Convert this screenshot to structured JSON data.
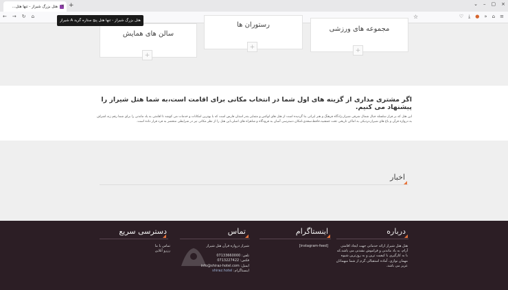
{
  "browser": {
    "tab_title": "هتل بزرگ شیراز - تنها هتل...",
    "tab_close": "×",
    "new_tab": "+",
    "tooltip": "هتل بزرگ شیراز - تنها هتل پنج ستاره گرید A شیراز",
    "nav_icons": [
      "←",
      "→",
      "↻",
      "⌂"
    ],
    "right_icons": [
      "♡",
      "⤓",
      "●",
      "»",
      "⌂",
      "≡"
    ],
    "window_buttons": [
      "⌄",
      "–",
      "▢",
      "×"
    ],
    "star": "☆"
  },
  "cards": {
    "halls": "سالن های همایش",
    "restaurants": "رستوران ها",
    "sports": "مجموعه های ورزشی",
    "plus": "+"
  },
  "intro": {
    "title": "اگر مشتری مداری از گزینه های اول شما در انتخاب مکانی برای اقامت است،به شما هتل شیراز را پیشنهاد می کنیم.",
    "text": "این هتل که بر فراز سلسله جبال شمال شرقی شیراز،زادگاه فرهنگ و هنر ایرانی بنا گردیده است از هتل های لوکس و متمایز بندر استان فارس است که با بهترین امکانات و خدمات می کوشد تا اقامتی به یاد ماندنی را برای شما رقم زند.اشراف به دروازه قرآن و باغ های شیراز،نزدیکی به اماکن تاریخی تخت جمشید،حافظ،سعدی،امکان دسترسی آسان به فرودگاه و شاهراه های اصلی،این هتل را از نظر مکانی نیز در شرایطی منحصر به فرد قرار داده است."
  },
  "news": {
    "title": "اخبار"
  },
  "footer": {
    "about": {
      "title": "درباره",
      "text": "هتل هتل شیراز ارائه خدماتی جهت ایجاد اقامتی آرام، به یاد ماندنی و فراموش نشدنی می باشد،که با به کارگیری با کیفیت ترین و به روزترین شیوه مهمان نوازی، آماده استقبالی گرم از شما میهمانان عزیز می باشد."
    },
    "instagram": {
      "title": "اینستاگرام",
      "feed": "[instagram-feed]"
    },
    "contact": {
      "title": "تماس",
      "address": "شیراز دروازه قرآن هتل شیراز",
      "phone": "تلفن: 07133660000",
      "fax": "فکس: 0713227422",
      "email": "ایمیل: info@shiraz-hotel.com",
      "instagram_label": "اینستاگرام:",
      "instagram_handle": "shiraz.hotel"
    },
    "quick": {
      "title": "دسترسی سریع",
      "links": [
        "تماس با ما",
        "رزرو آنلاین"
      ]
    }
  },
  "colors": {
    "accent": "#e8743b",
    "footer_bg": "#2c1e25"
  }
}
